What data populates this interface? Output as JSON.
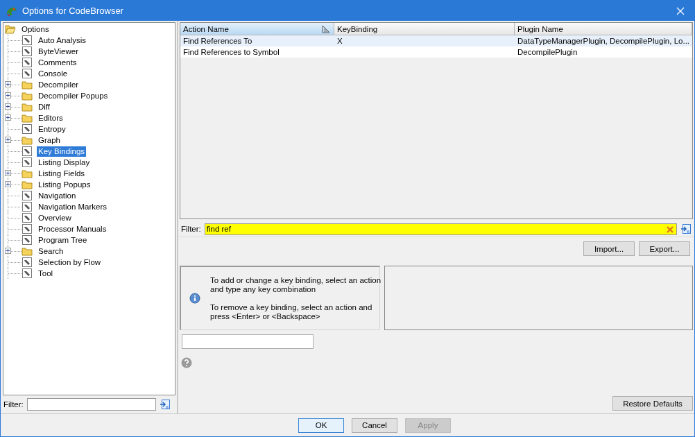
{
  "window": {
    "title": "Options for CodeBrowser"
  },
  "tree": {
    "label": "Options",
    "kind": "folder",
    "expanded": true,
    "selected": false,
    "children": [
      {
        "label": "Auto Analysis",
        "kind": "leaf",
        "selected": false
      },
      {
        "label": "ByteViewer",
        "kind": "leaf",
        "selected": false
      },
      {
        "label": "Comments",
        "kind": "leaf",
        "selected": false
      },
      {
        "label": "Console",
        "kind": "leaf",
        "selected": false
      },
      {
        "label": "Decompiler",
        "kind": "folder",
        "expanded": false,
        "selected": false
      },
      {
        "label": "Decompiler Popups",
        "kind": "folder",
        "expanded": false,
        "selected": false
      },
      {
        "label": "Diff",
        "kind": "folder",
        "expanded": false,
        "selected": false
      },
      {
        "label": "Editors",
        "kind": "folder",
        "expanded": false,
        "selected": false
      },
      {
        "label": "Entropy",
        "kind": "leaf",
        "selected": false
      },
      {
        "label": "Graph",
        "kind": "folder",
        "expanded": false,
        "selected": false
      },
      {
        "label": "Key Bindings",
        "kind": "leaf",
        "selected": true
      },
      {
        "label": "Listing Display",
        "kind": "leaf",
        "selected": false
      },
      {
        "label": "Listing Fields",
        "kind": "folder",
        "expanded": false,
        "selected": false
      },
      {
        "label": "Listing Popups",
        "kind": "folder",
        "expanded": false,
        "selected": false
      },
      {
        "label": "Navigation",
        "kind": "leaf",
        "selected": false
      },
      {
        "label": "Navigation Markers",
        "kind": "leaf",
        "selected": false
      },
      {
        "label": "Overview",
        "kind": "leaf",
        "selected": false
      },
      {
        "label": "Processor Manuals",
        "kind": "leaf",
        "selected": false
      },
      {
        "label": "Program Tree",
        "kind": "leaf",
        "selected": false
      },
      {
        "label": "Search",
        "kind": "folder",
        "expanded": false,
        "selected": false
      },
      {
        "label": "Selection by Flow",
        "kind": "leaf",
        "selected": false
      },
      {
        "label": "Tool",
        "kind": "leaf",
        "selected": false
      }
    ]
  },
  "tree_filter": {
    "label": "Filter:"
  },
  "table": {
    "columns": [
      {
        "label": "Action Name",
        "sorted": true
      },
      {
        "label": "KeyBinding",
        "sorted": false
      },
      {
        "label": "Plugin Name",
        "sorted": false
      }
    ],
    "rows": [
      {
        "cells": [
          "Find References To",
          "X",
          "DataTypeManagerPlugin, DecompilePlugin, Lo..."
        ],
        "selected": true
      },
      {
        "cells": [
          "Find References to Symbol",
          "",
          "DecompilePlugin"
        ],
        "selected": false
      }
    ]
  },
  "table_filter": {
    "label": "Filter:",
    "value": "find ref"
  },
  "actions": [
    "Import...",
    "Export..."
  ],
  "info": {
    "lines": [
      "To add or change a key binding, select an action and type any key combination",
      "To remove a key binding, select an action and press <Enter> or <Backspace>"
    ]
  },
  "restore_button": "Restore Defaults",
  "buttons": [
    {
      "label": "OK",
      "default": true,
      "disabled": false
    },
    {
      "label": "Cancel",
      "default": false,
      "disabled": false
    },
    {
      "label": "Apply",
      "default": false,
      "disabled": true
    }
  ]
}
